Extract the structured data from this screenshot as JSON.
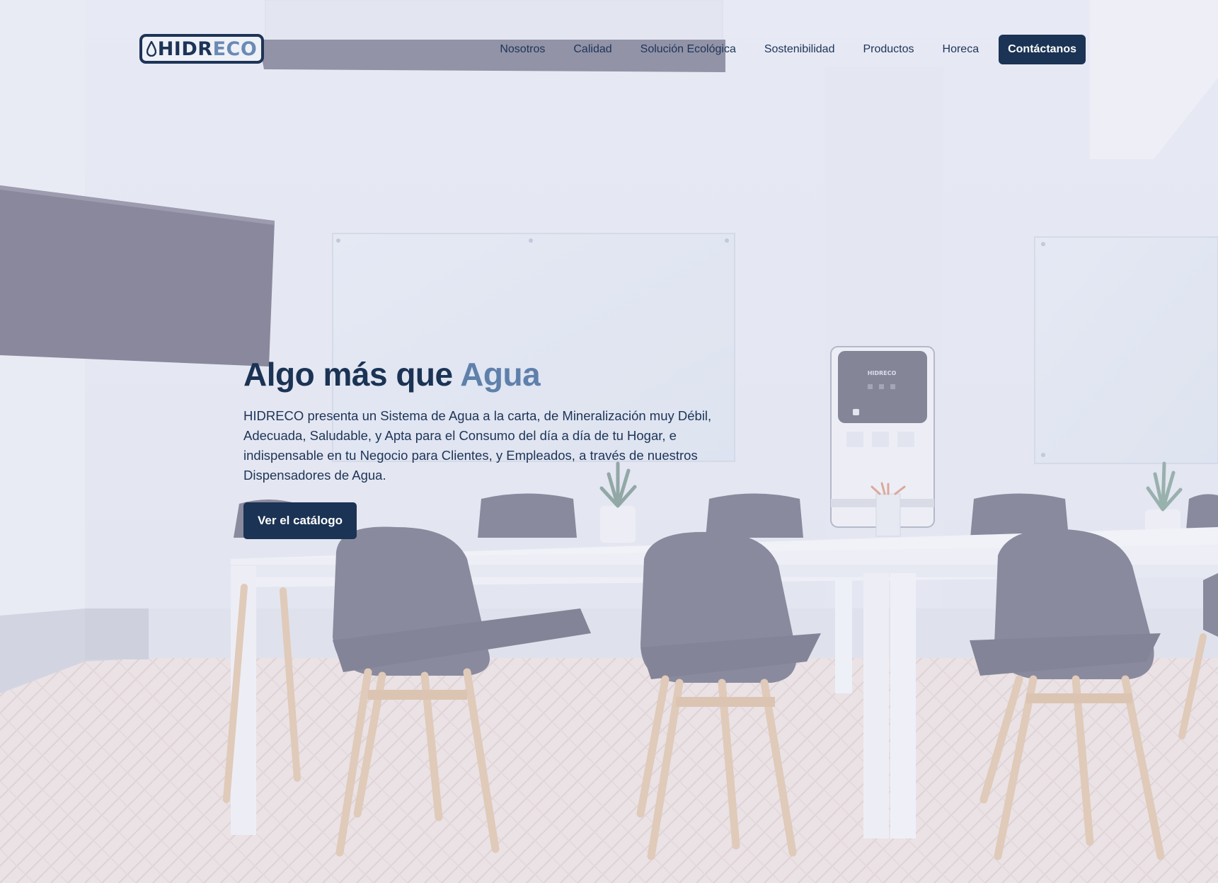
{
  "brand": {
    "logo_text_primary": "HIDR",
    "logo_text_accent": "ECO",
    "colors": {
      "navy": "#1b3354",
      "accent": "#5f80ab"
    }
  },
  "nav": {
    "items": [
      {
        "label": "Nosotros"
      },
      {
        "label": "Calidad"
      },
      {
        "label": "Solución Ecológica"
      },
      {
        "label": "Sostenibilidad"
      },
      {
        "label": "Productos"
      },
      {
        "label": "Horeca"
      }
    ],
    "cta_label": "Contáctanos"
  },
  "hero": {
    "title_main": "Algo más que ",
    "title_accent": "Agua",
    "description": "HIDRECO presenta un Sistema de Agua a la carta, de Mineralización muy Débil, Adecuada, Saludable, y Apta para el Consumo del día a día de tu Hogar, e indispensable en tu Negocio para Clientes, y Empleados, a través de nuestros Dispensadores de Agua.",
    "button_label": "Ver el catálogo"
  },
  "background": {
    "dispenser_logo_text": "HIDRECO",
    "icon": "office-meeting-room-photo"
  }
}
